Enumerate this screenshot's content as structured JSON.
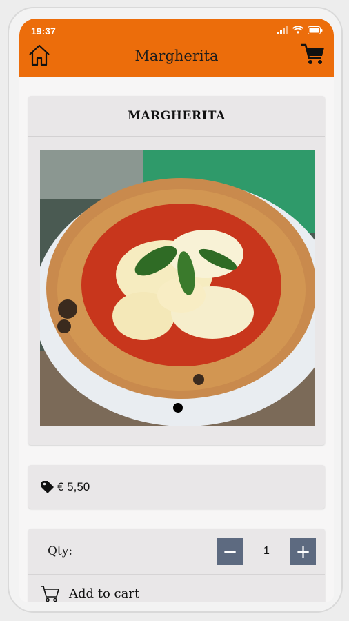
{
  "status": {
    "time": "19:37"
  },
  "header": {
    "title": "Margherita"
  },
  "product": {
    "title": "MARGHERITA",
    "price": "€ 5,50"
  },
  "order": {
    "qty_label": "Qty:",
    "minus_label": "−",
    "quantity": "1",
    "plus_label": "+",
    "add_to_cart_label": "Add to cart"
  },
  "icons": {
    "home": "home-icon",
    "cart": "cart-icon",
    "tag": "price-tag-icon",
    "add_cart": "cart-outline-icon"
  },
  "colors": {
    "accent": "#ec6d0b",
    "stepper": "#5d6a80",
    "card": "#e9e7e8"
  }
}
